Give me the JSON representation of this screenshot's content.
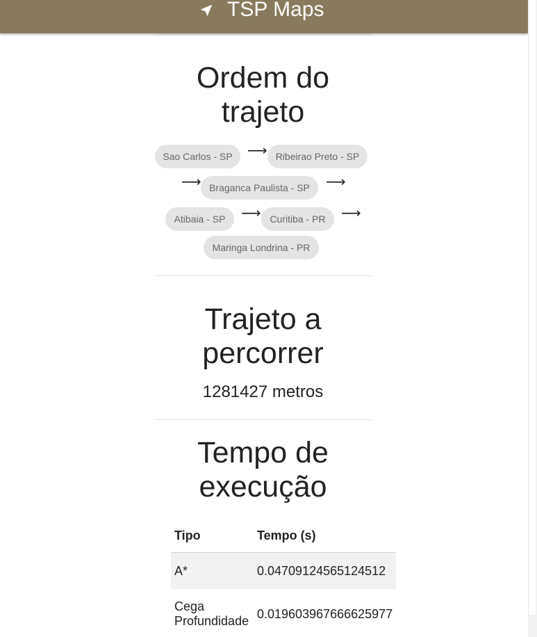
{
  "app": {
    "title": "TSP Maps",
    "nav_icon": "navigation-arrow-icon",
    "bar_color": "#887a5e"
  },
  "route_order": {
    "heading": "Ordem do trajeto",
    "stops": [
      "Sao Carlos - SP",
      "Ribeirao Preto - SP",
      "Braganca Paulista - SP",
      "Atibaia - SP",
      "Curitiba - PR",
      "Maringa Londrina - PR"
    ],
    "arrow_glyph": "⟶"
  },
  "distance": {
    "heading": "Trajeto a percorrer",
    "value": "1281427 metros"
  },
  "execution": {
    "heading": "Tempo de execução",
    "columns": [
      "Tipo",
      "Tempo (s)"
    ],
    "rows": [
      [
        "A*",
        "0.04709124565124512"
      ],
      [
        "Cega Profundidade",
        "0.019603967666625977"
      ]
    ]
  }
}
